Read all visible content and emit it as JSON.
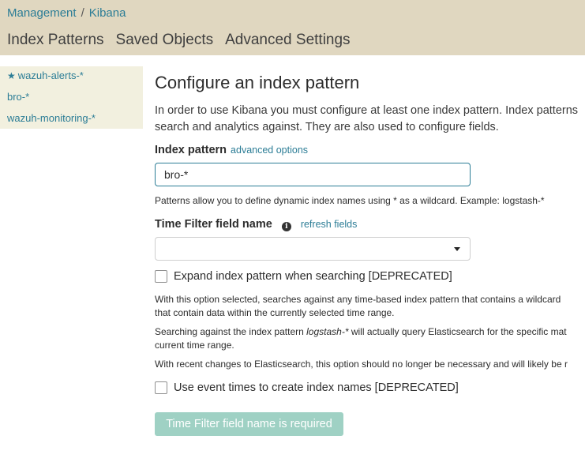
{
  "breadcrumb": {
    "management": "Management",
    "separator": "/",
    "kibana": "Kibana"
  },
  "tabs": [
    "Index Patterns",
    "Saved Objects",
    "Advanced Settings"
  ],
  "sidebar": {
    "items": [
      {
        "label": "wazuh-alerts-*",
        "icon": "star-icon",
        "default": true
      },
      {
        "label": "bro-*"
      },
      {
        "label": "wazuh-monitoring-*"
      }
    ]
  },
  "main": {
    "title": "Configure an index pattern",
    "intro_line1": "In order to use Kibana you must configure at least one index pattern. Index patterns",
    "intro_line2": "search and analytics against. They are also used to configure fields.",
    "index_pattern": {
      "label": "Index pattern",
      "advanced_link": "advanced options",
      "value": "bro-*",
      "help": "Patterns allow you to define dynamic index names using * as a wildcard. Example: logstash-*"
    },
    "time_filter": {
      "label": "Time Filter field name",
      "info_icon": "info-icon",
      "refresh_link": "refresh fields",
      "selected": ""
    },
    "expand": {
      "label": "Expand index pattern when searching [DEPRECATED]",
      "checked": false,
      "desc1_line1": "With this option selected, searches against any time-based index pattern that contains a wildcard",
      "desc1_line2": "that contain data within the currently selected time range.",
      "desc2_pre": "Searching against the index pattern ",
      "desc2_em": "logstash-*",
      "desc2_post": " will actually query Elasticsearch for the specific mat",
      "desc2_line2": "current time range.",
      "desc3": "With recent changes to Elasticsearch, this option should no longer be necessary and will likely be r"
    },
    "event_times": {
      "label": "Use event times to create index names [DEPRECATED]",
      "checked": false
    },
    "submit_button": "Time Filter field name is required"
  },
  "colors": {
    "header_bg": "#e0d7c0",
    "sidebar_bg": "#f2f0df",
    "link": "#2c7d96",
    "button_disabled": "#9fd1c4"
  }
}
